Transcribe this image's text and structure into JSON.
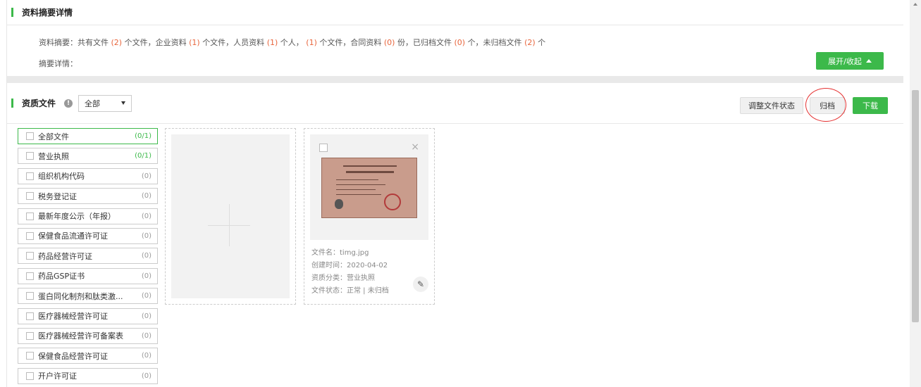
{
  "summary_section": {
    "title": "资料摘要详情",
    "summary_parts": {
      "p1": "资料摘要：共有文件",
      "n1": "(2)",
      "p2": "个文件，企业资料",
      "n2": "(1)",
      "p3": "个文件，人员资料",
      "n3": "(1)",
      "p4": "个人，",
      "n4": "(1)",
      "p5": "个文件，合同资料",
      "n5": "(0)",
      "p6": "份，已归档文件",
      "n6": "(0)",
      "p7": "个，未归档文件",
      "n7": "(2)",
      "p8": "个"
    },
    "detail_label": "摘要详情：",
    "toggle_button": "展开/收起"
  },
  "docs_section": {
    "title": "资质文件",
    "info_icon": "!",
    "filter_selected": "全部",
    "buttons": {
      "adjust_status": "调整文件状态",
      "archive": "归档",
      "download": "下载"
    }
  },
  "categories": [
    {
      "label": "全部文件",
      "count": "(0/1)"
    },
    {
      "label": "营业执照",
      "count": "(0/1)"
    },
    {
      "label": "组织机构代码",
      "count": "(0)"
    },
    {
      "label": "税务登记证",
      "count": "(0)"
    },
    {
      "label": "最新年度公示（年报）",
      "count": "(0)"
    },
    {
      "label": "保健食品流通许可证",
      "count": "(0)"
    },
    {
      "label": "药品经营许可证",
      "count": "(0)"
    },
    {
      "label": "药品GSP证书",
      "count": "(0)"
    },
    {
      "label": "蛋白同化制剂和肽类激...",
      "count": "(0)"
    },
    {
      "label": "医疗器械经营许可证",
      "count": "(0)"
    },
    {
      "label": "医疗器械经营许可备案表",
      "count": "(0)"
    },
    {
      "label": "保健食品经营许可证",
      "count": "(0)"
    },
    {
      "label": "开户许可证",
      "count": "(0)"
    }
  ],
  "file_card": {
    "close_icon": "×",
    "edit_icon": "✎",
    "filename": "文件名：timg.jpg",
    "created": "创建时间：2020-04-02",
    "category": "资质分类：营业执照",
    "status": "文件状态：正常 | 未归档"
  },
  "colors": {
    "accent": "#3cb94a",
    "number": "#e8663d",
    "highlight_circle": "#e53030"
  }
}
